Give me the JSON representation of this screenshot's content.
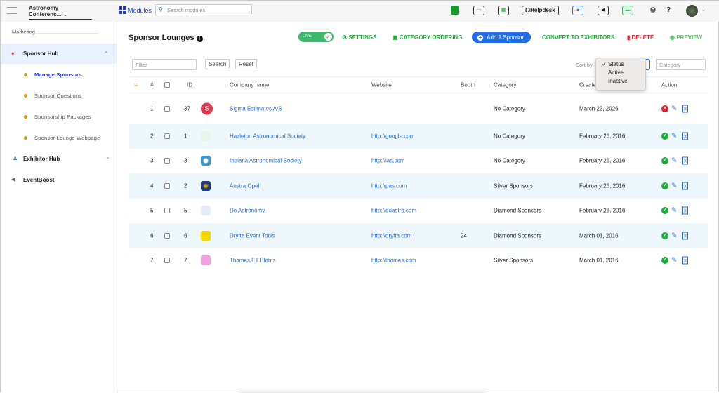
{
  "topbar": {
    "event": "Astronomy Conferenc...",
    "modules": "Modules",
    "search_placeholder": "Search modules",
    "helpdesk": "Helpdesk",
    "icons": [
      "briefcase-icon",
      "money-icon",
      "calendar-icon",
      "headset-icon",
      "rocket-icon",
      "megaphone-icon",
      "monitor-icon",
      "gear-icon",
      "help-icon",
      "avatar"
    ]
  },
  "sidebar": {
    "section": "Marketing",
    "sponsor_hub": "Sponsor Hub",
    "sub_items": [
      "Manage Sponsors",
      "Sponsor Questions",
      "Sponsorship Packages",
      "Sponsor Lounge Webpage"
    ],
    "exhibitor_hub": "Exhibitor Hub",
    "eventboost": "EventBoost"
  },
  "page": {
    "title": "Sponsor Lounges",
    "live": "LIVE",
    "settings": "SETTINGS",
    "category_ordering": "CATEGORY ORDERING",
    "add_sponsor": "Add A Sponsor",
    "convert": "CONVERT TO EXHIBITORS",
    "delete": "DELETE",
    "preview": "PREVIEW"
  },
  "filters": {
    "filter_placeholder": "Filter",
    "search": "Search",
    "reset": "Reset",
    "sort_by": "Sort by",
    "category_placeholder": "Category",
    "sort_options": [
      "Status",
      "Active",
      "Inactive"
    ],
    "selected": "Status"
  },
  "table": {
    "headers": {
      "num": "#",
      "id": "ID",
      "company": "Company name",
      "website": "Website",
      "booth": "Booth",
      "category": "Category",
      "created": "Create",
      "action": "Action"
    },
    "rows": [
      {
        "n": "1",
        "id": "37",
        "company": "Sigma Estimates A/S",
        "website": "",
        "booth": "",
        "category": "No Category",
        "created": "March 23, 2026",
        "active": false,
        "logo": "S"
      },
      {
        "n": "2",
        "id": "1",
        "company": "Hazleton Astronomical Society",
        "website": "http://google.com",
        "booth": "",
        "category": "No Category",
        "created": "February 26, 2016",
        "active": true
      },
      {
        "n": "3",
        "id": "3",
        "company": "Indiana Astronomical Society",
        "website": "http://ias.com",
        "booth": "",
        "category": "No Category",
        "created": "February 26, 2016",
        "active": true
      },
      {
        "n": "4",
        "id": "2",
        "company": "Austra Opel",
        "website": "http://pas.com",
        "booth": "",
        "category": "Silver Sponsors",
        "created": "February 26, 2016",
        "active": true
      },
      {
        "n": "5",
        "id": "5",
        "company": "Do Astronomy",
        "website": "http://doastro.com",
        "booth": "",
        "category": "Diamond Sponsors",
        "created": "February 26, 2016",
        "active": true
      },
      {
        "n": "6",
        "id": "6",
        "company": "Dryfta Event Tools",
        "website": "http://dryfta.com",
        "booth": "24",
        "category": "Diamond Sponsors",
        "created": "March 01, 2016",
        "active": true
      },
      {
        "n": "7",
        "id": "7",
        "company": "Thames ET Plants",
        "website": "http://thames.com",
        "booth": "",
        "category": "Silver Sponsors",
        "created": "March 01, 2016",
        "active": true
      }
    ]
  },
  "colors": {
    "accent": "#1f6fea",
    "green": "#1fae3a",
    "red": "#e8202a",
    "row_alt": "#eef7fb"
  }
}
